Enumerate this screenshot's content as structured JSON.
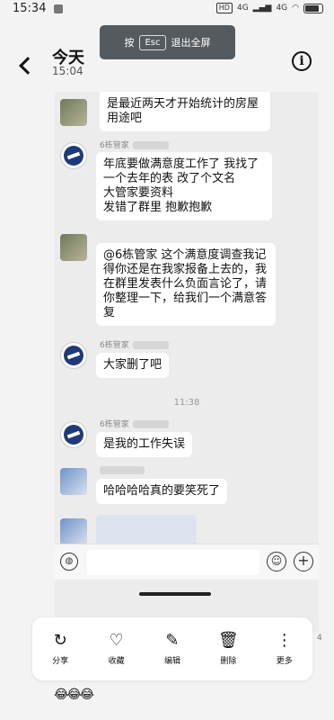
{
  "status_bar": {
    "time": "15:34",
    "right_text": "HD",
    "signal_labels": [
      "4G",
      "4G"
    ],
    "battery_icon": "battery-icon"
  },
  "header": {
    "title": "今天",
    "subtitle": "15:04",
    "back_icon": "back-chevron-icon",
    "info_icon": "info-icon"
  },
  "esc_toast": {
    "prefix": "按",
    "key": "Esc",
    "suffix": "退出全屏"
  },
  "messages": [
    {
      "sender": "",
      "text": "是最近两天才开始统计的房屋用途吧"
    },
    {
      "sender": "6栋管家",
      "text": "年底要做满意度工作了 我找了一个去年的表 改了个文名\n 大管家要资料\n发错了群里 抱歉抱歉"
    },
    {
      "sender": "",
      "text": "@6栋管家 这个满意度调查我记得你还是在我家报备上去的，我在群里发表什么负面言论了，请你整理一下，给我们一个满意答复"
    },
    {
      "sender": "6栋管家",
      "text": "大家删了吧"
    },
    {
      "sender": "6栋管家",
      "text": "是我的工作失误"
    },
    {
      "sender": "",
      "text": "哈哈哈哈真的要笑死了"
    }
  ],
  "timestamp": "11:38",
  "input_bar": {
    "voice_icon": "voice-icon",
    "emoji_icon": "emoji-icon",
    "plus_icon": "plus-icon"
  },
  "toolbar": {
    "items": [
      {
        "label": "分享",
        "icon": "share-icon"
      },
      {
        "label": "收藏",
        "icon": "heart-icon"
      },
      {
        "label": "编辑",
        "icon": "edit-icon"
      },
      {
        "label": "删除",
        "icon": "trash-icon"
      },
      {
        "label": "更多",
        "icon": "more-icon"
      }
    ],
    "page_number": "4"
  },
  "reactions": "😂😂😂"
}
